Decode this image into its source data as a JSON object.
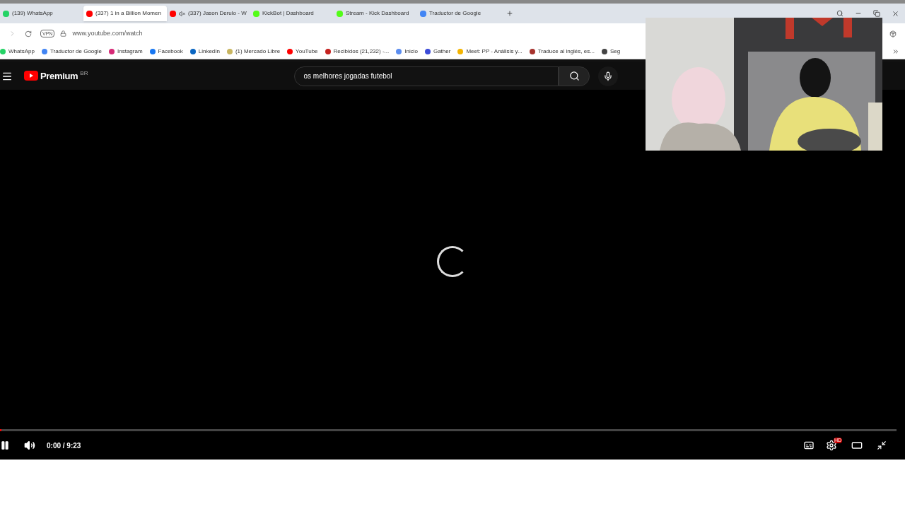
{
  "tabs": [
    {
      "label": "(139) WhatsApp",
      "kind": "whatsapp",
      "selected": false,
      "muted": false
    },
    {
      "label": "(337) 1 in a Billion Momen",
      "kind": "youtube",
      "selected": true,
      "muted": false
    },
    {
      "label": "(337) Jason Derulo - W",
      "kind": "youtube",
      "selected": false,
      "muted": true
    },
    {
      "label": "KickBot | Dashboard",
      "kind": "kick",
      "selected": false,
      "muted": false
    },
    {
      "label": "Stream - Kick Dashboard",
      "kind": "kick",
      "selected": false,
      "muted": false
    },
    {
      "label": "Traductor de Google",
      "kind": "translate",
      "selected": false,
      "muted": false
    }
  ],
  "address_bar": {
    "vpn": "VPN",
    "url": "www.youtube.com/watch"
  },
  "bookmarks": [
    {
      "label": "WhatsApp",
      "color": "#25d366"
    },
    {
      "label": "Traductor de Google",
      "color": "#4285f4"
    },
    {
      "label": "Instagram",
      "color": "#d62976"
    },
    {
      "label": "Facebook",
      "color": "#1877f2"
    },
    {
      "label": "LinkedIn",
      "color": "#0a66c2"
    },
    {
      "label": "(1) Mercado Libre",
      "color": "#c8b560"
    },
    {
      "label": "YouTube",
      "color": "#ff0000"
    },
    {
      "label": "Recibidos (21,232) -...",
      "color": "#c5221f"
    },
    {
      "label": "Inicio",
      "color": "#5b8def"
    },
    {
      "label": "Gather",
      "color": "#3b4bd8"
    },
    {
      "label": "Meet: PP - Análisis y...",
      "color": "#f4b400"
    },
    {
      "label": "Traduce al inglés, es...",
      "color": "#a6322d"
    },
    {
      "label": "Seg",
      "color": "#444444"
    }
  ],
  "youtube": {
    "logo": "Premium",
    "region": "BR",
    "search": "os melhores jogadas futebol"
  },
  "player": {
    "playing": true,
    "loading": true,
    "level": 0,
    "time": "0:00 / 9:23",
    "settings_badge": "HD"
  }
}
